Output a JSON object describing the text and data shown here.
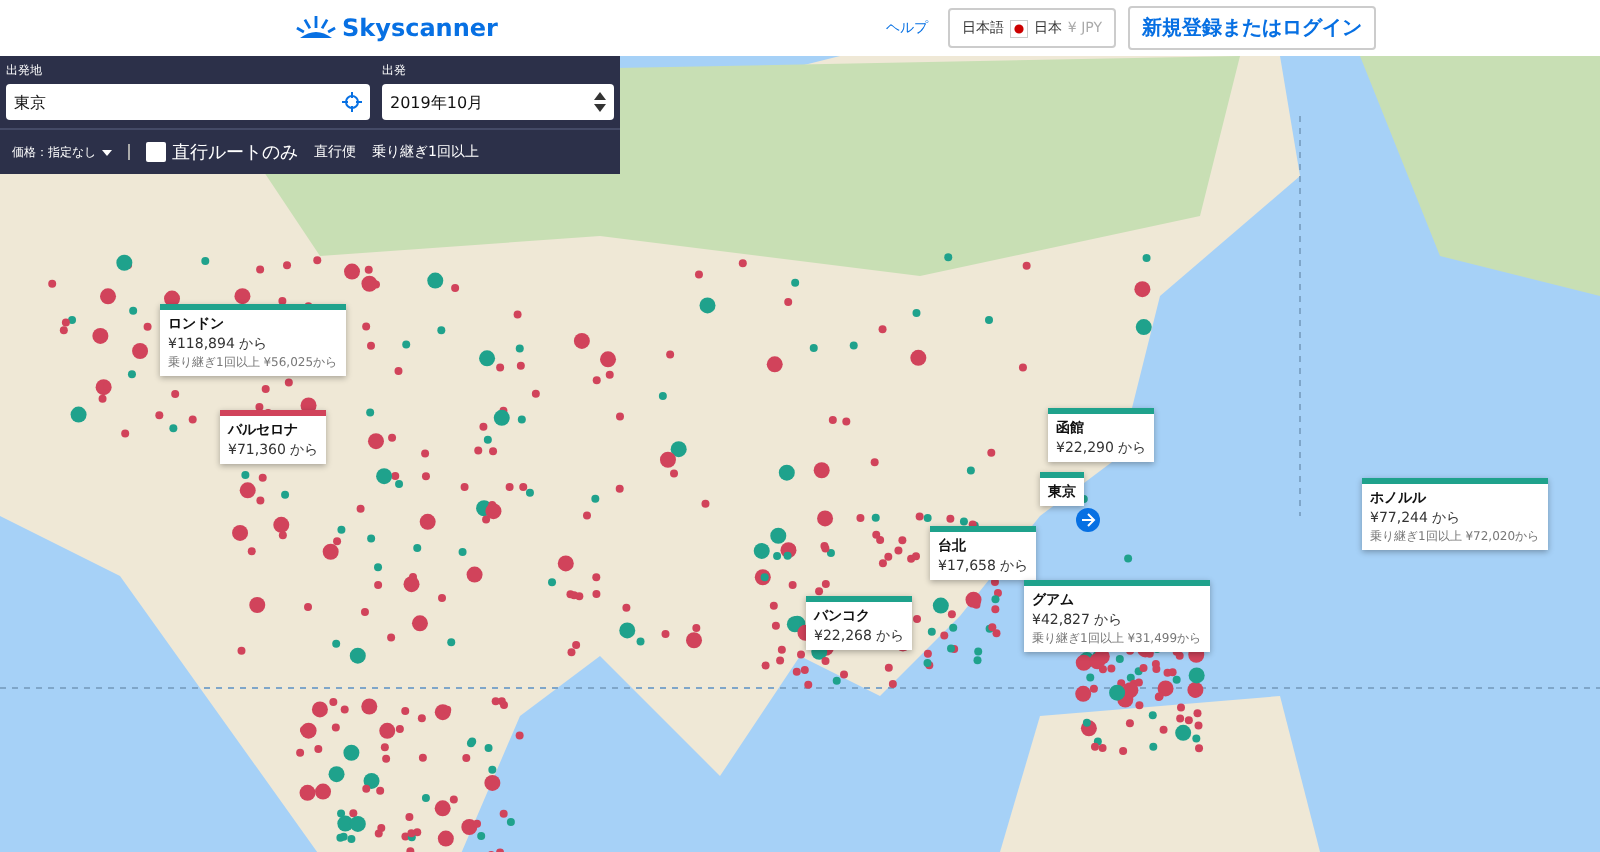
{
  "header": {
    "logo": "Skyscanner",
    "help": "ヘルプ",
    "locale": {
      "language": "日本語",
      "country": "日本",
      "currency": "¥ JPY"
    },
    "login": "新規登録またはログイン"
  },
  "search": {
    "origin_label": "出発地",
    "origin_value": "東京",
    "depart_label": "出発",
    "depart_value": "2019年10月",
    "price_filter": "価格：指定なし",
    "direct_only": {
      "label": "直行ルートのみ",
      "checked": false
    },
    "legend": [
      {
        "label": "直行便"
      },
      {
        "label": "乗り継ぎ1回以上"
      }
    ]
  },
  "destinations": [
    {
      "name": "ロンドン",
      "price": "¥118,894 から",
      "transfer": "乗り継ぎ1回以上 ¥56,025から",
      "color": "#1fa28c"
    },
    {
      "name": "バルセロナ",
      "price": "¥71,360 から",
      "color": "#d1435b"
    },
    {
      "name": "函館",
      "price": "¥22,290 から",
      "color": "#1fa28c"
    },
    {
      "name": "東京",
      "color": "#1fa28c"
    },
    {
      "name": "台北",
      "price": "¥17,658 から",
      "color": "#1fa28c"
    },
    {
      "name": "バンコク",
      "price": "¥22,268 から",
      "color": "#1fa28c"
    },
    {
      "name": "グアム",
      "price": "¥42,827 から",
      "transfer": "乗り継ぎ1回以上 ¥31,499から",
      "color": "#1fa28c"
    },
    {
      "name": "ホノルル",
      "price": "¥77,244 から",
      "transfer": "乗り継ぎ1回以上 ¥72,020から",
      "color": "#1fa28c"
    }
  ]
}
